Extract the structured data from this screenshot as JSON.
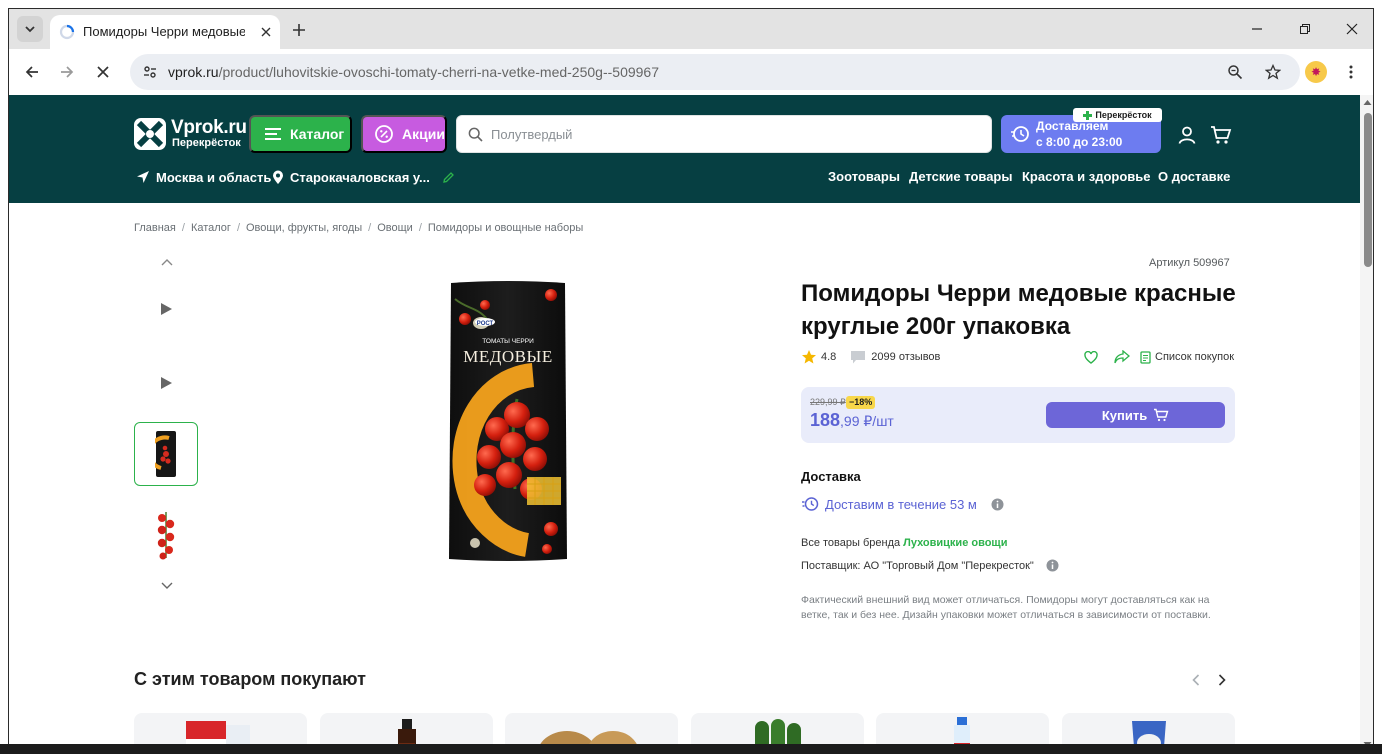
{
  "browser": {
    "tab_title": "Помидоры Черри медовые кр",
    "url_host": "vprok.ru",
    "url_path": "/product/luhovitskie-ovoschi-tomaty-cherri-na-vetke-med-250g--509967"
  },
  "header": {
    "logo_main": "Vprok.ru",
    "logo_sub": "Перекрёсток",
    "catalog_label": "Каталог",
    "promo_label": "Акции",
    "search_placeholder": "Полутвердый",
    "delivery_line1": "Доставляем",
    "delivery_line2": "с 8:00 до 23:00",
    "delivery_badge": "Перекрёсток",
    "region": "Москва и область",
    "address": "Старокачаловская у...",
    "nav": [
      "Зоотовары",
      "Детские товары",
      "Красота и здоровье",
      "О доставке"
    ]
  },
  "breadcrumbs": [
    "Главная",
    "Каталог",
    "Овощи, фрукты, ягоды",
    "Овощи",
    "Помидоры и овощные наборы"
  ],
  "product": {
    "sku": "Артикул 509967",
    "title": "Помидоры Черри медовые красные круглые 200г упаковка",
    "rating": "4.8",
    "reviews": "2099 отзывов",
    "shopping_list": "Список покупок",
    "old_price": "229,99 ₽",
    "discount": "−18%",
    "price_main": "188",
    "price_rest": ",99 ₽/шт",
    "buy_label": "Купить",
    "delivery_title": "Доставка",
    "delivery_time": "Доставим в течение 53 м",
    "brand_prefix": "Все товары бренда",
    "brand_name": "Луховицкие овощи",
    "supplier": "Поставщик: АО \"Торговый Дом \"Перекресток\"",
    "disclaimer": "Фактический внешний вид может отличаться. Помидоры могут доставляться как на ветке, так и без нее. Дизайн упаковки может отличаться в зависимости от поставки.",
    "package_brand": "РОСТ",
    "package_line1": "ТОМАТЫ ЧЕРРИ",
    "package_line2": "МЕДОВЫЕ"
  },
  "recommendations": {
    "title": "С этим товаром покупают"
  },
  "colors": {
    "header_bg": "#063f42",
    "catalog_green": "#2cb24b",
    "promo_purple": "#c75be0",
    "accent_violet": "#6d66d8"
  }
}
